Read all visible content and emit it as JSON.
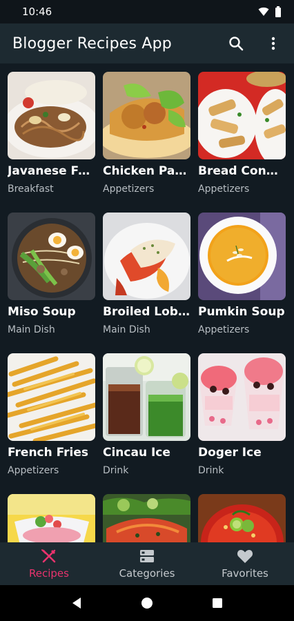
{
  "status": {
    "time": "10:46"
  },
  "app": {
    "title": "Blogger Recipes App",
    "search_icon": "search-icon",
    "more_icon": "more-vert-icon"
  },
  "recipes": [
    {
      "title": "Javanese Fri…",
      "category": "Breakfast"
    },
    {
      "title": "Chicken Para…",
      "category": "Appetizers"
    },
    {
      "title": "Bread Cone …",
      "category": "Appetizers"
    },
    {
      "title": "Miso Soup",
      "category": "Main Dish"
    },
    {
      "title": "Broiled Lobster",
      "category": "Main Dish"
    },
    {
      "title": "Pumkin Soup",
      "category": "Appetizers"
    },
    {
      "title": "French Fries",
      "category": "Appetizers"
    },
    {
      "title": "Cincau Ice",
      "category": "Drink"
    },
    {
      "title": "Doger Ice",
      "category": "Drink"
    },
    {
      "title": "",
      "category": ""
    },
    {
      "title": "",
      "category": ""
    },
    {
      "title": "",
      "category": ""
    }
  ],
  "bottom_nav": {
    "items": [
      {
        "label": "Recipes",
        "icon": "fork-knife-icon",
        "active": true
      },
      {
        "label": "Categories",
        "icon": "categories-icon",
        "active": false
      },
      {
        "label": "Favorites",
        "icon": "heart-icon",
        "active": false
      }
    ]
  },
  "colors": {
    "accent": "#e8336d",
    "background": "#121b22",
    "app_bar": "#1d2a31"
  }
}
